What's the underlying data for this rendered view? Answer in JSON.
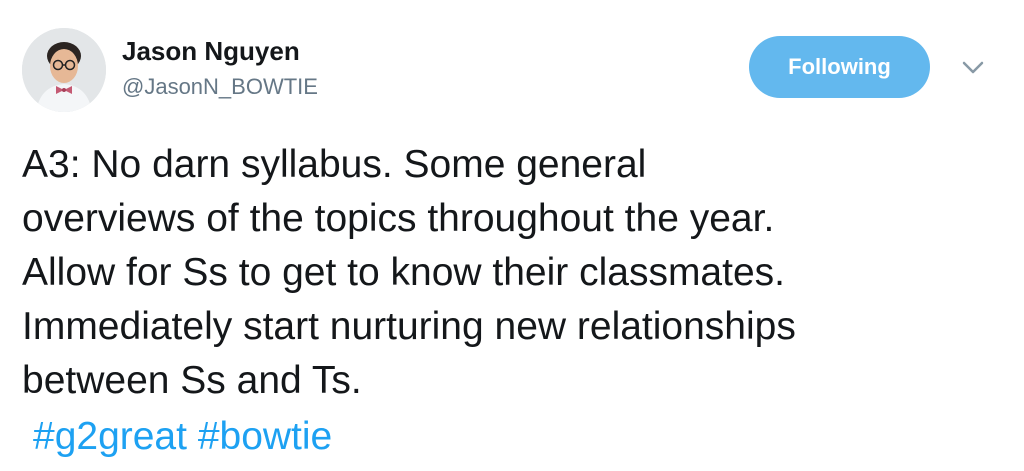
{
  "author": {
    "name": "Jason Nguyen",
    "handle": "@JasonN_BOWTIE",
    "avatar_icon": "profile-photo"
  },
  "actions": {
    "follow_label": "Following",
    "follow_color": "#63b8ee",
    "menu_icon": "chevron-down-icon"
  },
  "tweet": {
    "lines": [
      "A3: No darn syllabus.  Some general",
      "overviews of the topics throughout the year.",
      "Allow for Ss to get to know their classmates.",
      "Immediately start nurturing new relationships",
      "between Ss and Ts."
    ],
    "hashtags": [
      "#g2great",
      "#bowtie"
    ],
    "hashtag_color": "#1da1f2"
  }
}
